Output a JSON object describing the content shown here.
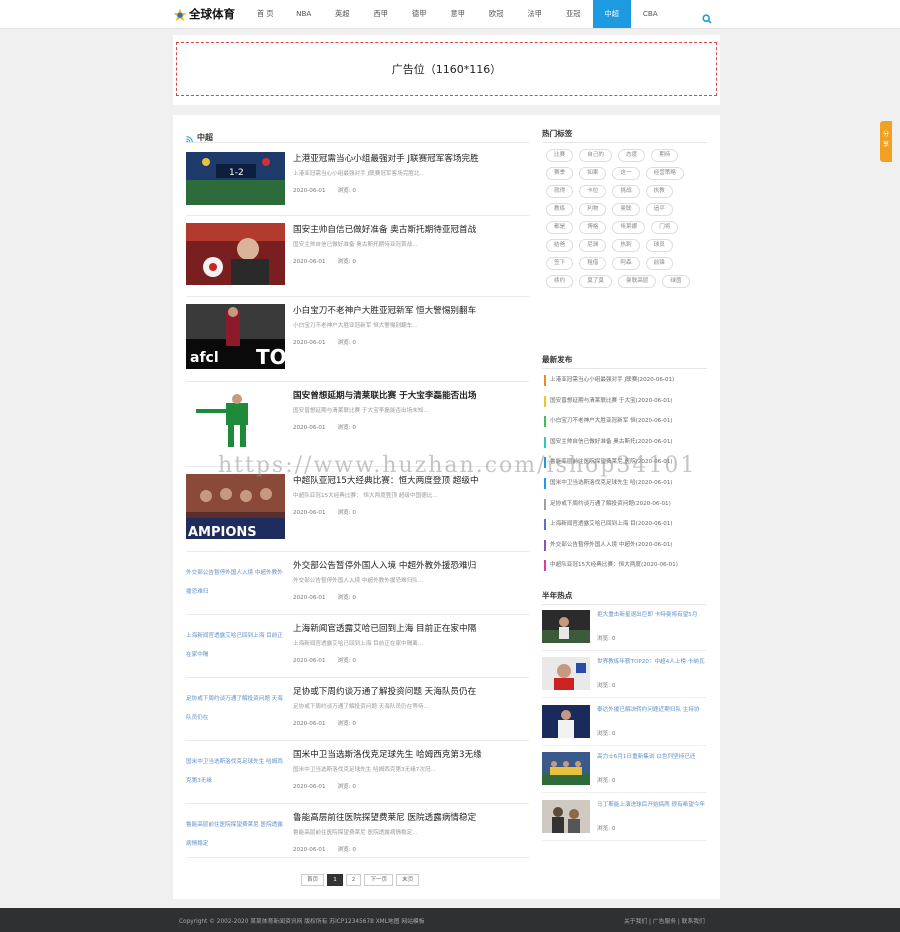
{
  "site": {
    "logo_text": "全球体育"
  },
  "nav": {
    "items": [
      "首 页",
      "NBA",
      "英超",
      "西甲",
      "德甲",
      "意甲",
      "欧冠",
      "法甲",
      "亚冠",
      "中超",
      "CBA"
    ],
    "active_index": 9
  },
  "ad": {
    "label": "广告位（1160*116）"
  },
  "section": {
    "title": "中超"
  },
  "articles": [
    {
      "title": "上港亚冠需当心小组最强对手 J联赛冠军客场完胜",
      "summary": "上港亚冠需当心小组最强对手 J联赛冠军客场完胜北...",
      "date": "2020-06-01",
      "views": "浏览: 0",
      "bold": false,
      "thumb": "stadium"
    },
    {
      "title": "国安主帅自信已做好准备 奥古斯托期待亚冠首战",
      "summary": "国安主帅自信已做好准备 奥古斯托期待亚冠首战...",
      "date": "2020-06-01",
      "views": "浏览: 0",
      "bold": false,
      "thumb": "press"
    },
    {
      "title": "小白宝刀不老神户大胜亚冠新军 恒大警惕别翻车",
      "summary": "小白宝刀不老神户大胜亚冠新军 恒大警惕别翻车...",
      "date": "2020-06-01",
      "views": "浏览: 0",
      "bold": false,
      "thumb": "afc"
    },
    {
      "title": "国安曾想延期与清莱联比赛 于大宝李磊能否出场",
      "summary": "国安曾想延期与清莱联比赛 于大宝李磊能否出场未知...",
      "date": "2020-06-01",
      "views": "浏览: 0",
      "bold": true,
      "thumb": "player"
    },
    {
      "title": "中超队亚冠15大经典比赛：恒大两度登顶 超级中",
      "summary": "中超队亚冠15大经典比赛： 恒大两度登顶 超级中国德比...",
      "date": "2020-06-01",
      "views": "浏览: 0",
      "bold": false,
      "thumb": "champions"
    },
    {
      "title": "外交部公告暂停外国人入境 中超外教外援恐难归",
      "summary": "外交部公告暂停外国人入境 中超外教外援恐难归队...",
      "date": "2020-06-01",
      "views": "浏览: 0",
      "bold": false,
      "thumb": "broken",
      "alt": "外交部公告暂停外国人入境 中超外教外援恐难归"
    },
    {
      "title": "上海新闻官透露艾哈已回到上海 目前正在家中隔",
      "summary": "上海新闻官透露艾哈已回到上海 目前正在家中隔离...",
      "date": "2020-06-01",
      "views": "浏览: 0",
      "bold": false,
      "thumb": "broken",
      "alt": "上海新闻官透露艾哈已回到上海 目前正在家中隔"
    },
    {
      "title": "足协或下周约谈万通了解投资问题 天海队员仍在",
      "summary": "足协或下周约谈万通了解投资问题 天海队员仍在等待...",
      "date": "2020-06-01",
      "views": "浏览: 0",
      "bold": false,
      "thumb": "broken",
      "alt": "足协或下周约谈万通了解投资问题 天海队员仍在"
    },
    {
      "title": "国米中卫当选斯洛伐克足球先生 哈姆西克第3无缘",
      "summary": "国米中卫当选斯洛伐克足球先生 哈姆西克第3无缘7次冠...",
      "date": "2020-06-01",
      "views": "浏览: 0",
      "bold": false,
      "thumb": "broken",
      "alt": "国米中卫当选斯洛伐克足球先生 哈姆西克第3无缘"
    },
    {
      "title": "鲁能高层前往医院探望费莱尼 医院透露病情稳定",
      "summary": "鲁能高层前往医院探望费莱尼 医院透露病情稳定...",
      "date": "2020-06-01",
      "views": "浏览: 0",
      "bold": false,
      "thumb": "broken",
      "alt": "鲁能高层前往医院探望费莱尼 医院透露病情稳定"
    }
  ],
  "pager": {
    "items": [
      "首页",
      "1",
      "2",
      "下一页",
      "末页"
    ],
    "current_index": 1
  },
  "sidebar": {
    "tags_title": "热门标签",
    "tags": [
      "比赛",
      "自己的",
      "态度",
      "期待",
      "赛季",
      "如果",
      "这一",
      "经营策略",
      "就得",
      "卡拉",
      "挑战",
      "执教",
      "教练",
      "利物",
      "曼联",
      "追平",
      "都是",
      "博格",
      "埃莱娜",
      "门将",
      "结爸",
      "尼渊",
      "热刺",
      "球员",
      "签下",
      "租借",
      "阿森",
      "前锋",
      "续约",
      "莫了莫",
      "曼联高层",
      "绿茵"
    ],
    "new_title": "最新发布",
    "new_items": [
      {
        "text": "上港亚冠需当心小组最强对手 J联赛(2020-06-01)",
        "color": "#f08a24"
      },
      {
        "text": "国安曾想延期与清莱联比赛 于大宝(2020-06-01)",
        "color": "#f3c02e"
      },
      {
        "text": "小白宝刀不老神户大胜亚冠新军 恒(2020-06-01)",
        "color": "#3fbf5a"
      },
      {
        "text": "国安主帅自信已做好准备 奥古斯托(2020-06-01)",
        "color": "#2ec7c9"
      },
      {
        "text": "鲁能高层前往医院探望费莱尼 医院(2020-06-01)",
        "color": "#1e9be0"
      },
      {
        "text": "国米中卫当选斯洛伐克足球先生 哈(2020-06-01)",
        "color": "#1e9be0"
      },
      {
        "text": "足协或下周约谈万通了解投资问题(2020-06-01)",
        "color": "#9aa0a6"
      },
      {
        "text": "上海新闻官透露艾哈已回到上海 目(2020-06-01)",
        "color": "#5b6fd6"
      },
      {
        "text": "外交部公告暂停外国人入境 中超外(2020-06-01)",
        "color": "#7e57c2"
      },
      {
        "text": "中超队亚冠15大经典比赛：恒大两度(2020-06-01)",
        "color": "#d63fa3"
      }
    ],
    "hot_title": "半年热点",
    "hot_items": [
      {
        "title": "拒大重击新星退出巨即 卡特曼将有望5月",
        "views": "浏览: 0",
        "thumb": "tennis"
      },
      {
        "title": "世界教练年薪TOP20：中超4人上榜 卡纳瓦",
        "views": "浏览: 0",
        "thumb": "coach"
      },
      {
        "title": "泰达外援已解决转约问题近期归队 主持协",
        "views": "浏览: 0",
        "thumb": "player2"
      },
      {
        "title": "高力士6月1日重新集训 以色列坚持已还",
        "views": "浏览: 0",
        "thumb": "team"
      },
      {
        "title": "马丁斯能上演进球后开始搞两 很有希望今年",
        "views": "浏览: 0",
        "thumb": "crowd"
      }
    ]
  },
  "footer": {
    "copyright": "Copyright © 2002-2020 某某体育新闻资讯网 版权所有 苏ICP12345678 XML地图 网站模板",
    "links": "关于我们 | 广告服务 | 联系我们"
  },
  "share": {
    "label": "分享"
  },
  "watermark": {
    "text": "https://www.huzhan.com/ishop34101"
  },
  "colors": {
    "accent": "#1e9be0",
    "ad_border": "#d84848",
    "footer_bg": "#2f3032",
    "share_bg": "#f0a023"
  }
}
